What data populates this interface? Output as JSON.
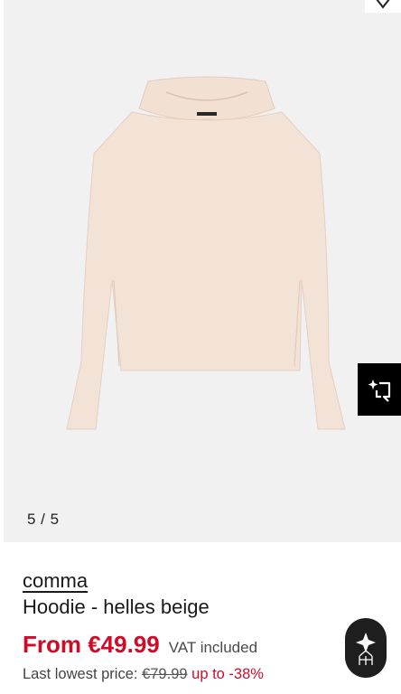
{
  "gallery": {
    "counter": "5 / 5",
    "image_alt": "Hoodie - helles beige"
  },
  "product": {
    "brand": "comma",
    "name": "Hoodie - helles beige",
    "price": "From €49.99",
    "vat": "VAT included",
    "lowest_label": "Last lowest price:",
    "old_price": "€79.99",
    "discount": "up to -38%"
  },
  "colors": {
    "accent_red": "#d10a26",
    "product_beige": "#f3e2d6"
  }
}
